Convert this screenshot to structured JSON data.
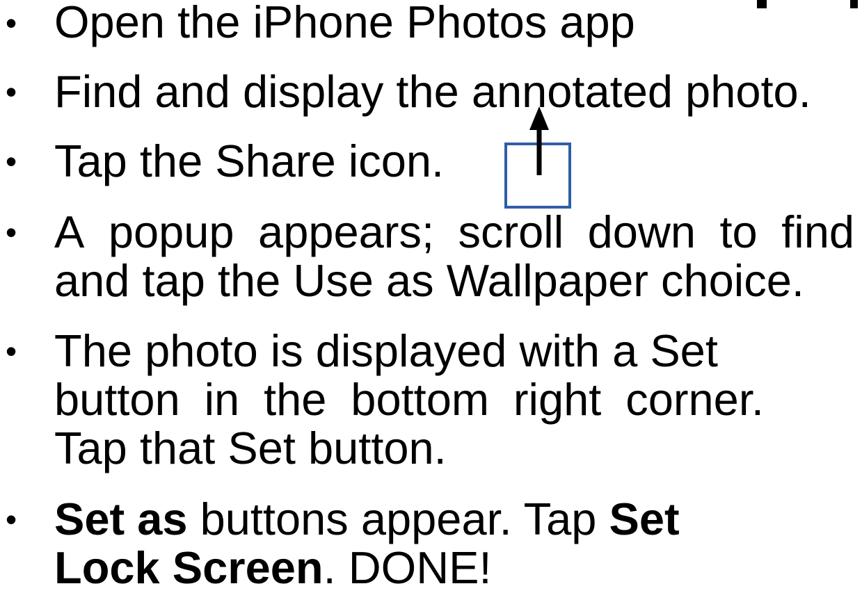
{
  "bullets": [
    {
      "text": "Open the iPhone Photos app"
    },
    {
      "text": "Find and display the annotated photo."
    },
    {
      "text": "Tap the Share icon."
    },
    {
      "line1_words": [
        "A",
        "popup",
        "appears;",
        "scroll",
        "down",
        "to",
        "find"
      ],
      "line2": "and tap the Use as Wallpaper choice."
    },
    {
      "line1": "The photo is displayed with a Set",
      "line2_words": [
        "button",
        "in",
        "the",
        "bottom",
        "right",
        "corner."
      ],
      "line3": "Tap that Set button."
    },
    {
      "bold1": "Set as",
      "text1": " buttons appear. Tap ",
      "bold2": "Set",
      "bold3": "Lock Screen",
      "text2": ". DONE!"
    }
  ],
  "bullet_symbol": "•",
  "share_icon_box_color": "#2f5ea8"
}
